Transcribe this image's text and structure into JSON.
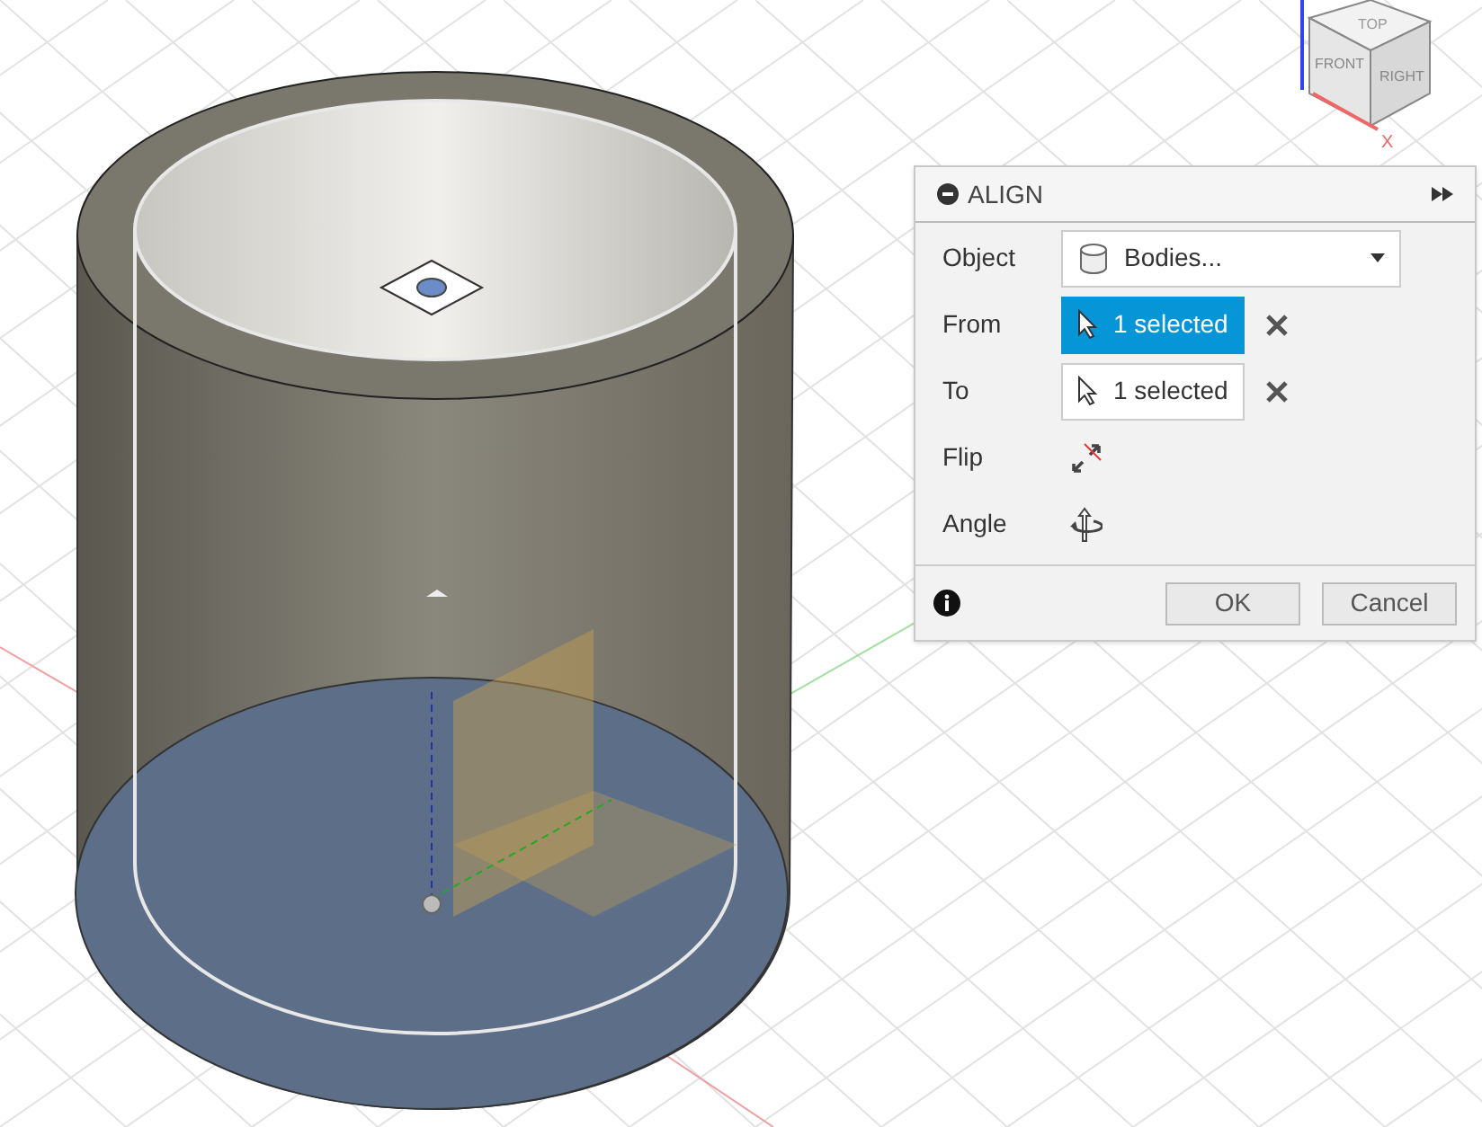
{
  "viewport": {
    "view_cube": {
      "top": "TOP",
      "front": "FRONT",
      "right": "RIGHT",
      "x_axis": "X"
    }
  },
  "dialog": {
    "title": "ALIGN",
    "rows": [
      {
        "kind": "dropdown",
        "label": "Object",
        "value": "Bodies..."
      },
      {
        "kind": "selection",
        "label": "From",
        "value": "1 selected",
        "selected": true
      },
      {
        "kind": "selection",
        "label": "To",
        "value": "1 selected",
        "selected": false
      },
      {
        "kind": "flip",
        "label": "Flip"
      },
      {
        "kind": "angle",
        "label": "Angle"
      }
    ],
    "buttons": [
      {
        "label": "OK"
      },
      {
        "label": "Cancel"
      }
    ]
  }
}
